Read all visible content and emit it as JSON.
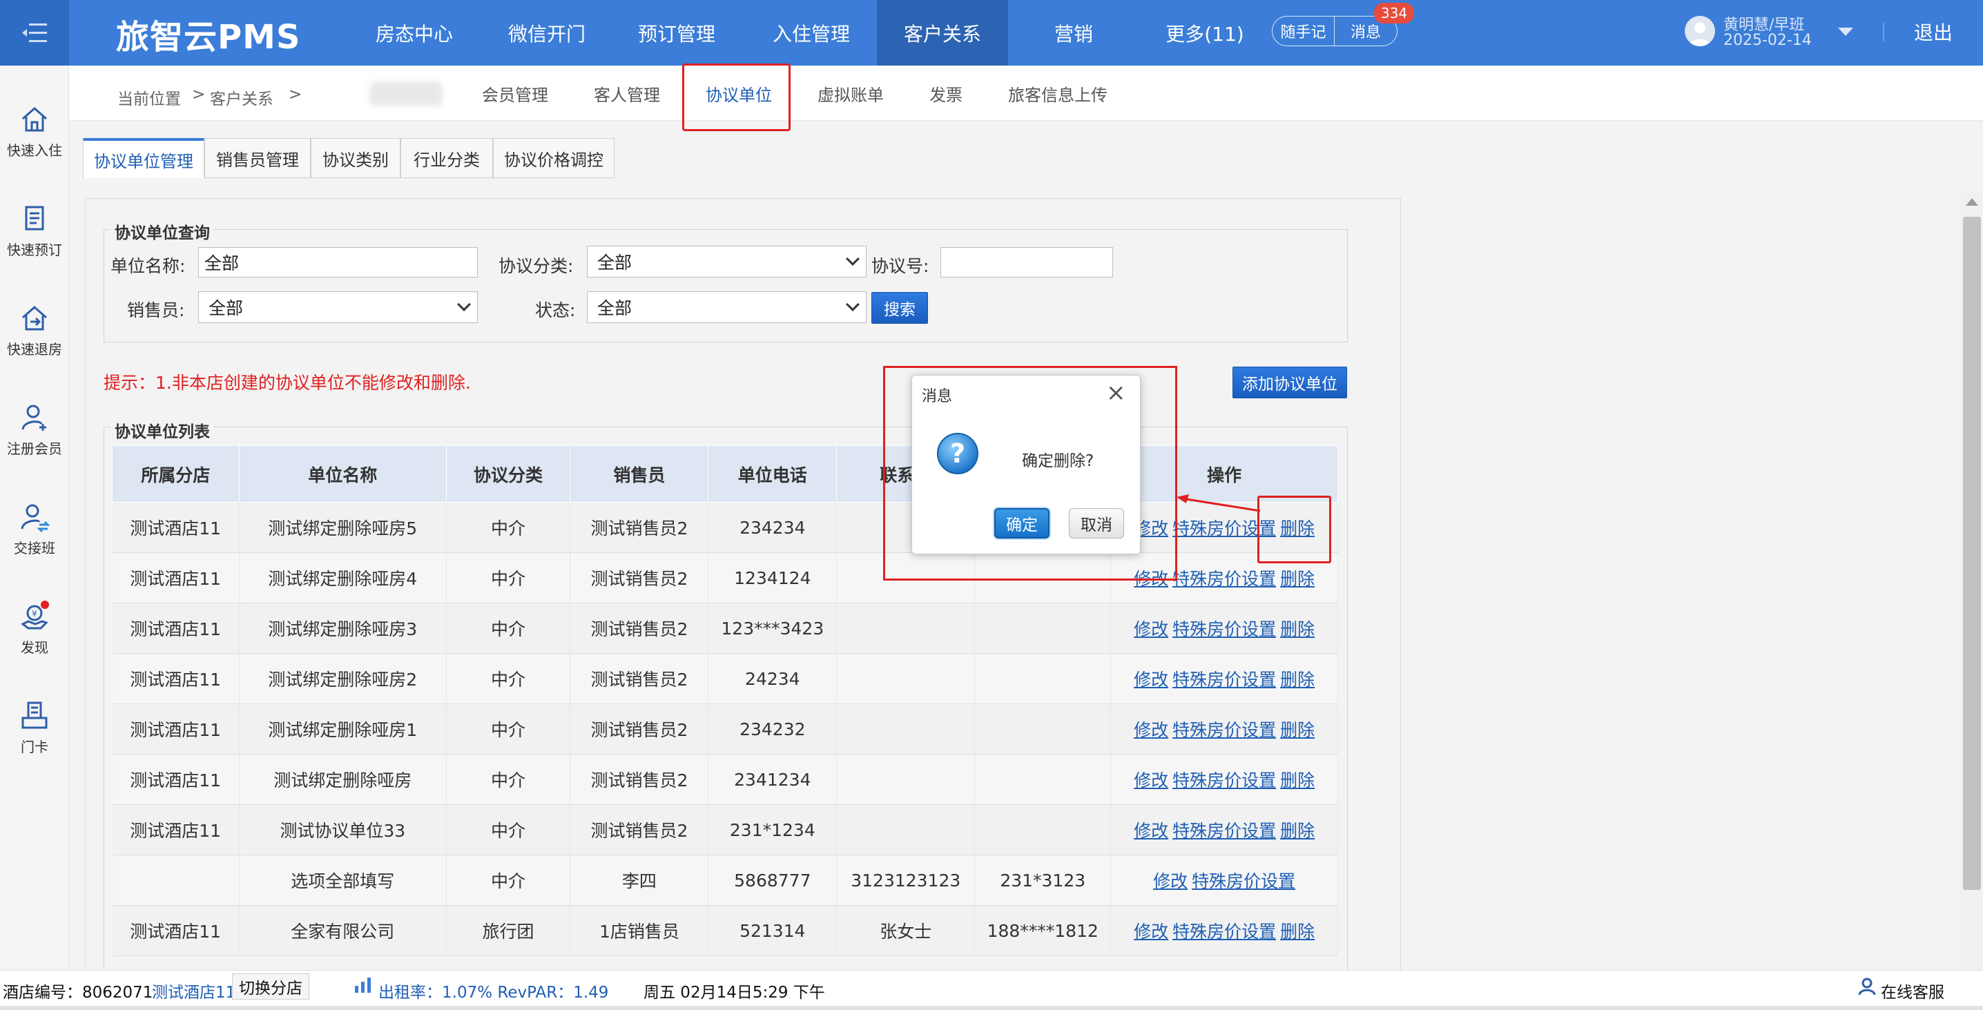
{
  "app": {
    "logo": "旅智云PMS"
  },
  "topnav": {
    "items": [
      "房态中心",
      "微信开门",
      "预订管理",
      "入住管理",
      "客户关系",
      "营销",
      "更多(11)"
    ],
    "active": "客户关系",
    "notes": "随手记",
    "messages": "消息",
    "message_count": "334",
    "user": "黄明慧/早班",
    "date": "2025-02-14",
    "logout": "退出"
  },
  "sidebar": {
    "items": [
      {
        "label": "快速入住",
        "icon": "home-icon"
      },
      {
        "label": "快速预订",
        "icon": "notebook-icon"
      },
      {
        "label": "快速退房",
        "icon": "checkout-icon"
      },
      {
        "label": "注册会员",
        "icon": "add-user-icon"
      },
      {
        "label": "交接班",
        "icon": "shift-change-icon"
      },
      {
        "label": "发现",
        "icon": "discover-icon"
      },
      {
        "label": "门卡",
        "icon": "card-reader-icon"
      }
    ]
  },
  "breadcrumb": {
    "current": "当前位置",
    "sep": ">",
    "section": "客户关系"
  },
  "module_tabs": [
    "会员管理",
    "客人管理",
    "协议单位",
    "虚拟账单",
    "发票",
    "旅客信息上传"
  ],
  "module_tab_active": "协议单位",
  "subtabs": [
    "协议单位管理",
    "销售员管理",
    "协议类别",
    "行业分类",
    "协议价格调控"
  ],
  "subtab_active": "协议单位管理",
  "query": {
    "legend": "协议单位查询",
    "unit_name_label": "单位名称:",
    "unit_name_value": "全部",
    "category_label": "协议分类:",
    "category_value": "全部",
    "agreement_no_label": "协议号:",
    "agreement_no_value": "",
    "salesperson_label": "销售员:",
    "salesperson_value": "全部",
    "status_label": "状态:",
    "status_value": "全部",
    "search_button": "搜索"
  },
  "tip": "提示：1.非本店创建的协议单位不能修改和删除.",
  "add_button": "添加协议单位",
  "list": {
    "legend": "协议单位列表",
    "columns": [
      "所属分店",
      "单位名称",
      "协议分类",
      "销售员",
      "单位电话",
      "联系人",
      "",
      "操作"
    ],
    "rows": [
      {
        "branch": "测试酒店11",
        "name": "测试绑定删除哑房5",
        "category": "中介",
        "sales": "测试销售员2",
        "phone": "234234",
        "contact": "",
        "mobile": "",
        "ops": [
          "修改",
          "特殊房价设置",
          "删除"
        ]
      },
      {
        "branch": "测试酒店11",
        "name": "测试绑定删除哑房4",
        "category": "中介",
        "sales": "测试销售员2",
        "phone": "1234124",
        "contact": "",
        "mobile": "",
        "ops": [
          "修改",
          "特殊房价设置",
          "删除"
        ]
      },
      {
        "branch": "测试酒店11",
        "name": "测试绑定删除哑房3",
        "category": "中介",
        "sales": "测试销售员2",
        "phone": "123***3423",
        "contact": "",
        "mobile": "",
        "ops": [
          "修改",
          "特殊房价设置",
          "删除"
        ]
      },
      {
        "branch": "测试酒店11",
        "name": "测试绑定删除哑房2",
        "category": "中介",
        "sales": "测试销售员2",
        "phone": "24234",
        "contact": "",
        "mobile": "",
        "ops": [
          "修改",
          "特殊房价设置",
          "删除"
        ]
      },
      {
        "branch": "测试酒店11",
        "name": "测试绑定删除哑房1",
        "category": "中介",
        "sales": "测试销售员2",
        "phone": "234232",
        "contact": "",
        "mobile": "",
        "ops": [
          "修改",
          "特殊房价设置",
          "删除"
        ]
      },
      {
        "branch": "测试酒店11",
        "name": "测试绑定删除哑房",
        "category": "中介",
        "sales": "测试销售员2",
        "phone": "2341234",
        "contact": "",
        "mobile": "",
        "ops": [
          "修改",
          "特殊房价设置",
          "删除"
        ]
      },
      {
        "branch": "测试酒店11",
        "name": "测试协议单位33",
        "category": "中介",
        "sales": "测试销售员2",
        "phone": "231*1234",
        "contact": "",
        "mobile": "",
        "ops": [
          "修改",
          "特殊房价设置",
          "删除"
        ]
      },
      {
        "branch": "",
        "name": "选项全部填写",
        "category": "中介",
        "sales": "李四",
        "phone": "5868777",
        "contact": "3123123123",
        "mobile": "231*3123",
        "ops": [
          "修改",
          "特殊房价设置"
        ]
      },
      {
        "branch": "测试酒店11",
        "name": "全家有限公司",
        "category": "旅行团",
        "sales": "1店销售员",
        "phone": "521314",
        "contact": "张女士",
        "mobile": "188****1812",
        "ops": [
          "修改",
          "特殊房价设置",
          "删除"
        ]
      }
    ]
  },
  "dialog": {
    "title": "消息",
    "message": "确定删除?",
    "ok": "确定",
    "cancel": "取消"
  },
  "footer": {
    "hotel_no_label": "酒店编号：8062071",
    "hotel_name": "测试酒店11",
    "switch": "切换分店",
    "occupancy": "出租率：1.07% RevPAR：1.49",
    "datetime": "周五 02月14日5:29 下午",
    "support": "在线客服"
  },
  "colors": {
    "topbar": "#3b7dd8",
    "accent": "#1e5fb5",
    "warn": "#e02020",
    "badge": "#e74c3c"
  }
}
